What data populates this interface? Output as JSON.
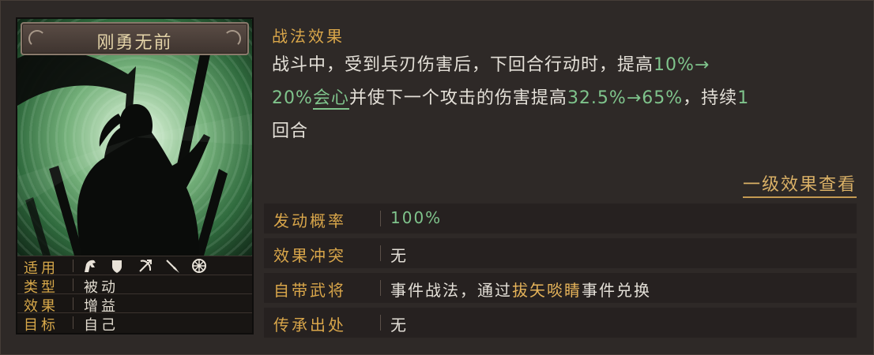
{
  "card": {
    "title": "刚勇无前",
    "rows": [
      {
        "key": "适用",
        "icons": [
          "cavalry-icon",
          "shield-icon",
          "bow-icon",
          "spear-icon",
          "siege-wheel-icon"
        ]
      },
      {
        "key": "类型",
        "value": "被动"
      },
      {
        "key": "效果",
        "value": "增益"
      },
      {
        "key": "目标",
        "value": "自己"
      }
    ]
  },
  "effect": {
    "title": "战法效果",
    "line1_a": "战斗中，受到兵刃伤害后，下回合行动时，提高",
    "line1_b": "10%→",
    "line2_a": "20%",
    "line2_kw": "会心",
    "line2_b": "并使下一个攻击的伤害提高",
    "line2_c": "32.5%→65%",
    "line2_d": "，持续",
    "line2_e": "1",
    "line3": "回合"
  },
  "level_link": "一级效果查看",
  "table": {
    "prob_key": "发动概率",
    "prob_val": "100%",
    "conflict_key": "效果冲突",
    "conflict_val": "无",
    "general_key": "自带武将",
    "general_val_a": "事件战法，通过",
    "general_val_hl": "拔矢啖睛",
    "general_val_b": "事件兑换",
    "inherit_key": "传承出处",
    "inherit_val": "无"
  },
  "colors": {
    "accent_gold": "#d9a64a",
    "highlight_green": "#7fc48c",
    "text": "#e4e0d8",
    "panel": "#262120"
  }
}
